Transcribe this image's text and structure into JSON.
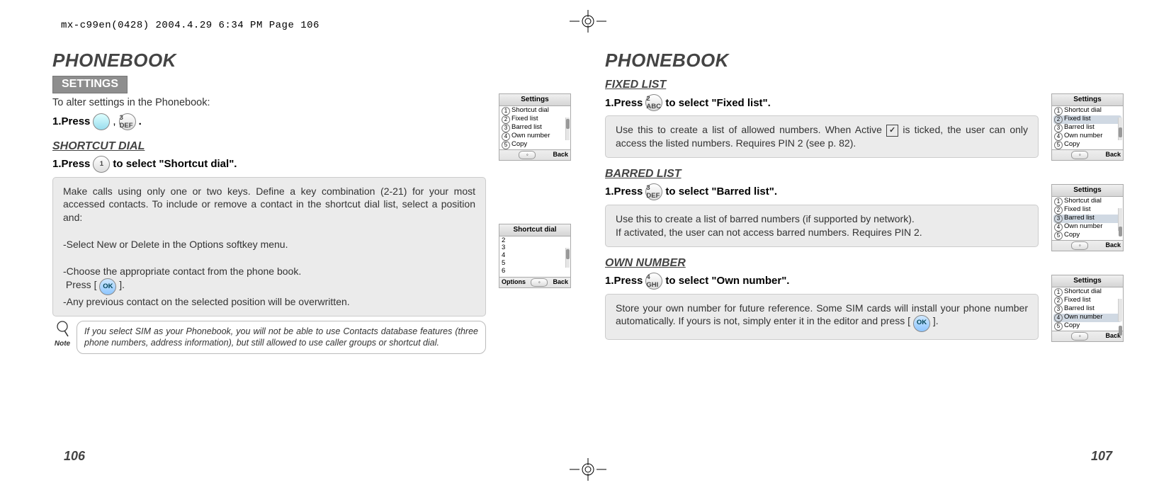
{
  "meta": {
    "header_line": "mx-c99en(0428)  2004.4.29  6:34 PM  Page 106"
  },
  "left": {
    "title": "PHONEBOOK",
    "section_tag": "SETTINGS",
    "intro": "To alter settings in the Phonebook:",
    "step1_prefix": "1.Press",
    "step1_key1": "",
    "step1_key2": "3\nDEF",
    "h_shortcut": "SHORTCUT DIAL",
    "shortcut_step_prefix": "1.Press",
    "shortcut_key": "1",
    "shortcut_step_suffix": "to select \"Shortcut dial\".",
    "shortcut_box": {
      "p1": "Make calls using only one or two keys. Define a key combination (2-21) for your most accessed contacts. To include or remove a contact in the shortcut dial list, select a position and:",
      "p2": "-Select New or Delete in the Options softkey menu.",
      "p3": "-Choose the appropriate contact from the phone book.",
      "p4a": "Press [",
      "ok": "OK",
      "p4b": " ].",
      "p5": "-Any previous contact on the selected position will be overwritten."
    },
    "note_label": "Note",
    "note_text": "If you select SIM as your Phonebook, you will not be able to use Contacts database features (three phone numbers, address information), but still allowed to use caller groups or shortcut dial.",
    "sshot_settings": {
      "title": "Settings",
      "items": [
        "Shortcut dial",
        "Fixed list",
        "Barred list",
        "Own number",
        "Copy"
      ],
      "back": "Back"
    },
    "sshot_shortcut": {
      "title": "Shortcut dial",
      "items": [
        "2",
        "3",
        "4",
        "5",
        "6"
      ],
      "options": "Options",
      "back": "Back"
    },
    "page_num": "106"
  },
  "right": {
    "title": "PHONEBOOK",
    "step_prefix": "1.Press",
    "h_fixed": "FIXED LIST",
    "fixed_key": "2\nABC",
    "fixed_suffix": "to select \"Fixed list\".",
    "fixed_box_a": "Use this to create a list of allowed numbers. When Active ",
    "fixed_box_b": " is ticked, the user can only access the listed numbers. Requires PIN 2 (see p. 82).",
    "h_barred": "BARRED LIST",
    "barred_key": "3\nDEF",
    "barred_suffix": "to select \"Barred list\".",
    "barred_box_a": "Use this to create a list of barred numbers (if supported by network).",
    "barred_box_b": "If activated, the user can not access barred numbers. Requires PIN 2.",
    "h_own": "OWN NUMBER",
    "own_key": "4\nGHI",
    "own_suffix": "to select \"Own number\".",
    "own_box_a": "Store your own number for future reference. Some SIM cards will install your phone number automatically. If yours is not, simply enter it in the editor and press [ ",
    "own_ok": "OK",
    "own_box_b": " ].",
    "sshots": [
      {
        "title": "Settings",
        "items": [
          "Shortcut dial",
          "Fixed list",
          "Barred list",
          "Own number",
          "Copy"
        ],
        "back": "Back"
      },
      {
        "title": "Settings",
        "items": [
          "Shortcut dial",
          "Fixed list",
          "Barred list",
          "Own number",
          "Copy"
        ],
        "back": "Back"
      },
      {
        "title": "Settings",
        "items": [
          "Shortcut dial",
          "Fixed list",
          "Barred list",
          "Own number",
          "Copy"
        ],
        "back": "Back"
      }
    ],
    "page_num": "107"
  }
}
